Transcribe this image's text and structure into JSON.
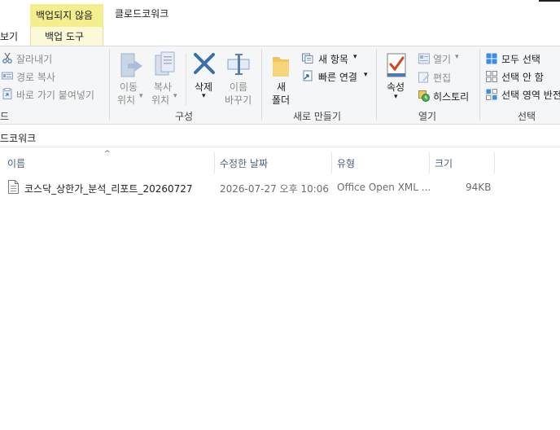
{
  "titlebar": {
    "context_tab_head": "백업되지 않음",
    "window_title": "클로드코워크"
  },
  "tabs": {
    "view_partial": "보기",
    "context_tab": "백업 도구"
  },
  "ribbon": {
    "clipboard": {
      "cut": "잘라내기",
      "copy_path": "경로 복사",
      "paste_shortcut": "바로 가기 붙여넣기",
      "group_partial": "드"
    },
    "organize": {
      "move_to": [
        "이동",
        "위치"
      ],
      "copy_to": [
        "복사",
        "위치"
      ],
      "delete": "삭제",
      "rename": [
        "이름",
        "바꾸기"
      ],
      "group": "구성"
    },
    "new": {
      "new_folder": [
        "새",
        "폴더"
      ],
      "new_item": "새 항목",
      "easy_access": "빠른 연결",
      "group": "새로 만들기"
    },
    "open": {
      "properties": "속성",
      "open": "열기",
      "edit": "편집",
      "history": "히스토리",
      "group": "열기"
    },
    "select": {
      "select_all": "모두 선택",
      "select_none": "선택 안 함",
      "invert_selection": "선택 영역 반전",
      "group": "선택"
    }
  },
  "address": {
    "path_partial": "드코워크"
  },
  "columns": {
    "name": "이름",
    "date": "수정한 날짜",
    "type": "유형",
    "size": "크기"
  },
  "files": [
    {
      "name": "코스닥_상한가_분석_리포트_20260727",
      "date": "2026-07-27 오후 10:06",
      "type": "Office Open XML ...",
      "size": "94KB"
    }
  ],
  "colors": {
    "context_tab": "#f5ee8e",
    "ribbon_bg": "#f5f6f7",
    "header_text": "#4c607a",
    "accent_blue": "#1e6fd9"
  }
}
